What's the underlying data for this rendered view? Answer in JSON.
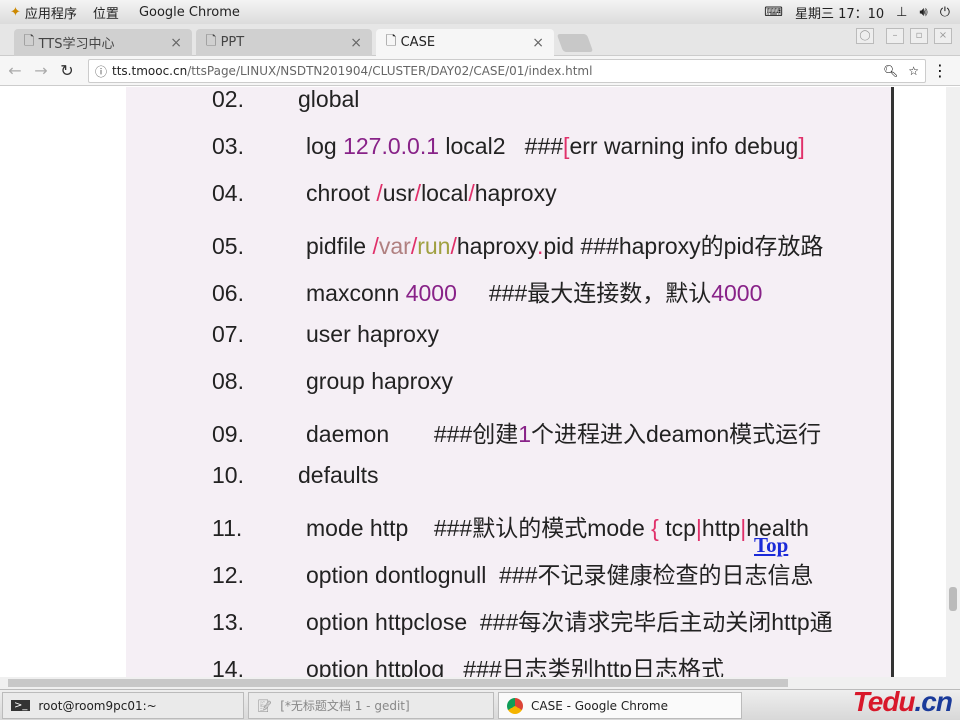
{
  "topbar": {
    "apps": "应用程序",
    "places": "位置",
    "app_name": "Google Chrome",
    "datetime": "星期三 17：10"
  },
  "tabs": [
    {
      "label": "TTS学习中心"
    },
    {
      "label": "PPT"
    },
    {
      "label": "CASE"
    }
  ],
  "address": {
    "host": "tts.tmooc.cn",
    "path": "/ttsPage/LINUX/NSDTN201904/CLUSTER/DAY02/CASE/01/index.html"
  },
  "code_lines": [
    {
      "n": "02.",
      "indent": 0,
      "segs": [
        {
          "t": "global"
        }
      ]
    },
    {
      "n": "03.",
      "indent": 1,
      "segs": [
        {
          "t": "log "
        },
        {
          "t": "127.0.0.1",
          "c": "num"
        },
        {
          "t": " local2   ###"
        },
        {
          "t": "[",
          "c": "sl"
        },
        {
          "t": "err warning info debug"
        },
        {
          "t": "]",
          "c": "sl"
        }
      ]
    },
    {
      "n": "04.",
      "indent": 1,
      "segs": [
        {
          "t": "chroot "
        },
        {
          "t": "/",
          "c": "sl"
        },
        {
          "t": "usr"
        },
        {
          "t": "/",
          "c": "sl"
        },
        {
          "t": "local"
        },
        {
          "t": "/",
          "c": "sl"
        },
        {
          "t": "haproxy"
        }
      ]
    },
    {
      "n": "05.",
      "indent": 1,
      "segs": [
        {
          "t": "pidfile "
        },
        {
          "t": "/",
          "c": "sl"
        },
        {
          "t": "var",
          "c": "var"
        },
        {
          "t": "/",
          "c": "sl"
        },
        {
          "t": "run",
          "c": "run"
        },
        {
          "t": "/",
          "c": "sl"
        },
        {
          "t": "haproxy"
        },
        {
          "t": ".",
          "c": "sl"
        },
        {
          "t": "pid ###haproxy的pid存放路"
        }
      ]
    },
    {
      "n": "06.",
      "indent": 1,
      "segs": [
        {
          "t": "maxconn "
        },
        {
          "t": "4000",
          "c": "num"
        },
        {
          "t": "     ###最大连接数，默认"
        },
        {
          "t": "4000",
          "c": "num"
        }
      ]
    },
    {
      "n": "07.",
      "indent": 1,
      "segs": [
        {
          "t": "user haproxy"
        }
      ]
    },
    {
      "n": "08.",
      "indent": 1,
      "segs": [
        {
          "t": "group haproxy"
        }
      ]
    },
    {
      "n": "09.",
      "indent": 1,
      "segs": [
        {
          "t": "daemon       ###创建"
        },
        {
          "t": "1",
          "c": "num"
        },
        {
          "t": "个进程进入deamon模式运行"
        }
      ]
    },
    {
      "n": "10.",
      "indent": 0,
      "segs": [
        {
          "t": "defaults"
        }
      ]
    },
    {
      "n": "11.",
      "indent": 1,
      "segs": [
        {
          "t": "mode http    ###默认的模式mode "
        },
        {
          "t": "{",
          "c": "sl"
        },
        {
          "t": " tcp"
        },
        {
          "t": "|",
          "c": "sl"
        },
        {
          "t": "http"
        },
        {
          "t": "|",
          "c": "sl"
        },
        {
          "t": "health"
        }
      ]
    },
    {
      "n": "12.",
      "indent": 1,
      "segs": [
        {
          "t": "option dontlognull  ###不记录健康检查的日志信息"
        }
      ]
    },
    {
      "n": "13.",
      "indent": 1,
      "segs": [
        {
          "t": "option httpclose  ###每次请求完毕后主动关闭http通"
        }
      ]
    },
    {
      "n": "14.",
      "indent": 1,
      "segs": [
        {
          "t": "option httplog   ###日志类别http日志格式"
        }
      ]
    }
  ],
  "top_link": "Top",
  "taskbar": [
    {
      "label": "root@room9pc01:~"
    },
    {
      "label": "[*无标题文档 1 - gedit]"
    },
    {
      "label": "CASE - Google Chrome"
    }
  ],
  "logo": "Tedu.cn",
  "colors": {
    "number": "#882288",
    "punct": "#e0306a",
    "link": "#1a2ad8"
  }
}
